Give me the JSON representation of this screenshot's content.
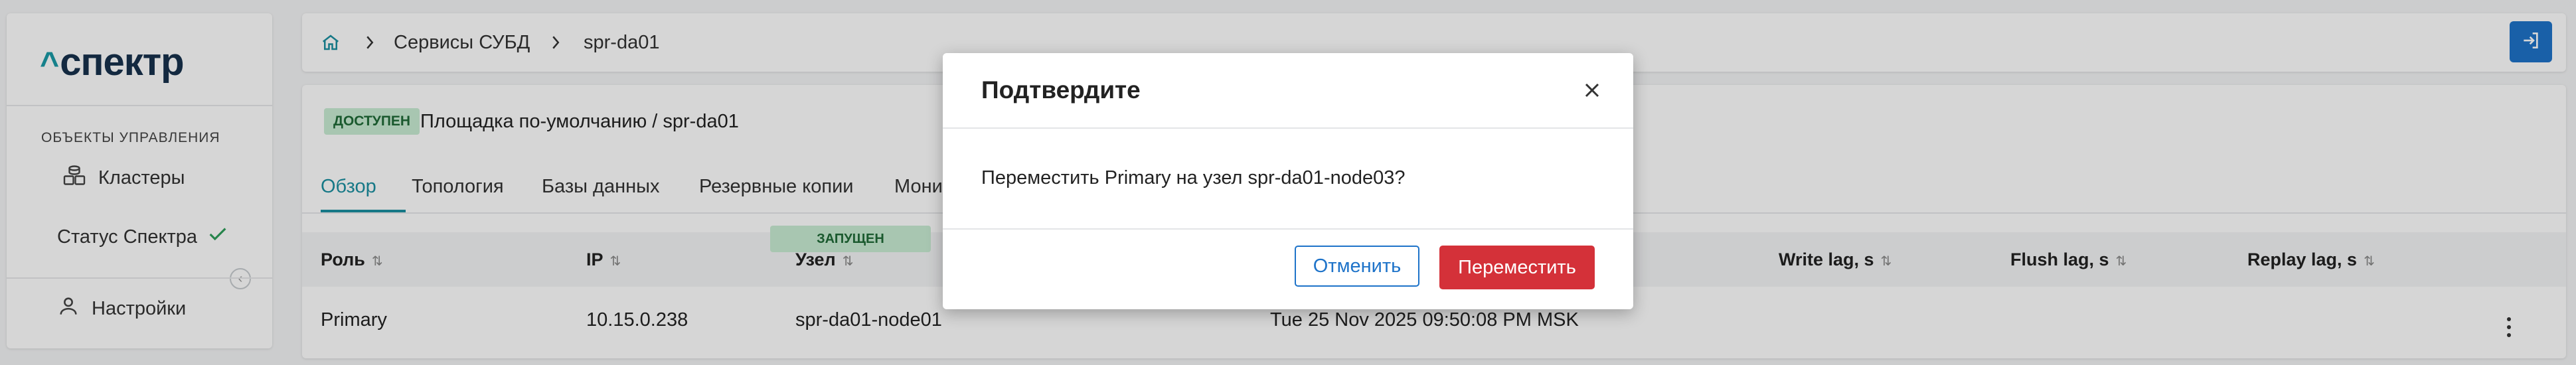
{
  "sidebar": {
    "logo_caret": "^",
    "logo_text": "спектр",
    "section_title": "ОБЪЕКТЫ УПРАВЛЕНИЯ",
    "items": [
      {
        "label": "Кластеры",
        "icon": "database-stack-icon"
      },
      {
        "label": "Статус Спектра",
        "icon": "checkmark-icon"
      }
    ],
    "settings_label": "Настройки",
    "collapse_icon": "chevron-left-icon"
  },
  "breadcrumb": {
    "home_icon": "home-icon",
    "items": [
      "Сервисы СУБД",
      "spr-da01"
    ]
  },
  "header": {
    "exit_icon": "logout-icon",
    "accent": "#1e73c9"
  },
  "instance": {
    "status_badge": "ДОСТУПЕН",
    "path": "Площадка по-умолчанию /  spr-da01"
  },
  "tabs": [
    {
      "label": "Обзор",
      "active": true
    },
    {
      "label": "Топология",
      "active": false
    },
    {
      "label": "Базы данных",
      "active": false
    },
    {
      "label": "Резервные копии",
      "active": false
    },
    {
      "label": "Мони",
      "active": false
    }
  ],
  "table": {
    "columns": [
      "Роль",
      "IP",
      "Узел",
      "Write lag, s",
      "Flush lag, s",
      "Replay lag, s"
    ],
    "rows": [
      {
        "role": "Primary",
        "ip": "10.15.0.238",
        "node": "spr-da01-node01",
        "status": "ЗАПУЩЕН",
        "time": "Tue 25 Nov 2025 09:50:08 PM MSK"
      }
    ]
  },
  "modal": {
    "title": "Подтвердите",
    "message": "Переместить Primary на узел spr-da01-node03?",
    "cancel_label": "Отменить",
    "confirm_label": "Переместить",
    "confirm_color": "#d43139"
  }
}
